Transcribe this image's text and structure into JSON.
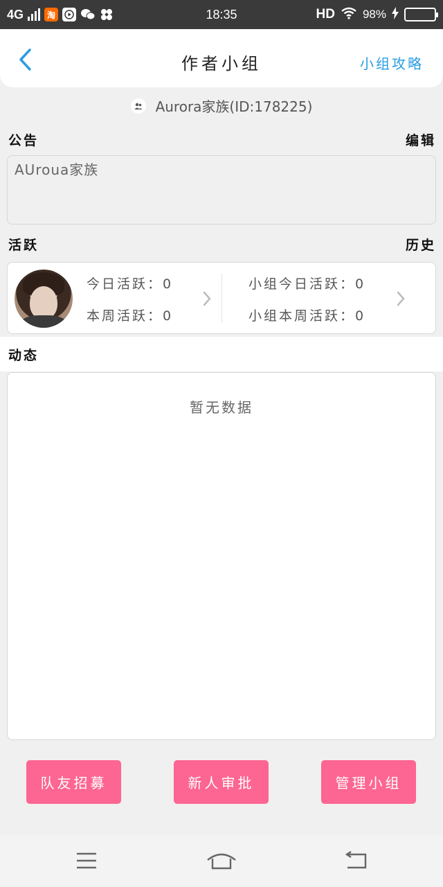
{
  "status_bar": {
    "network": "4G",
    "time": "18:35",
    "hd": "HD",
    "battery": "98%",
    "battery_level": 0.98,
    "app_icons": [
      "taobao-icon",
      "video-icon",
      "wechat-icon",
      "pinwheel-icon"
    ]
  },
  "header": {
    "title": "作者小组",
    "right_link": "小组攻略"
  },
  "group": {
    "name_id": "Aurora家族(ID:178225)"
  },
  "notice": {
    "label": "公告",
    "edit": "编辑",
    "content": "AUroua家族"
  },
  "activity": {
    "label": "活跃",
    "history": "历史",
    "today": "今日活跃：0",
    "week": "本周活跃：0",
    "group_today": "小组今日活跃：0",
    "group_week": "小组本周活跃：0"
  },
  "feed": {
    "label": "动态",
    "empty": "暂无数据"
  },
  "buttons": {
    "recruit": "队友招募",
    "approve": "新人审批",
    "manage": "管理小组"
  },
  "colors": {
    "accent_blue": "#2a9de0",
    "pink": "#fd6592",
    "status_bar": "#3a3a3a"
  }
}
